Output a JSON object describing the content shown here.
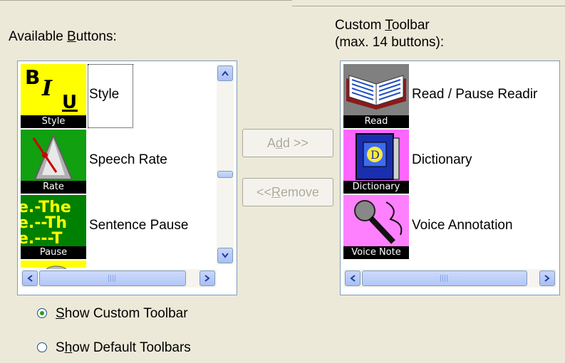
{
  "available": {
    "label_pre": "Available ",
    "label_accel": "B",
    "label_post": "uttons:",
    "items": [
      {
        "label": "Style",
        "icon": "style-icon",
        "caption": "Style"
      },
      {
        "label": "Speech Rate",
        "icon": "metronome-icon",
        "caption": "Rate"
      },
      {
        "label": "Sentence Pause",
        "icon": "sentence-pause-icon",
        "caption": "Pause"
      }
    ]
  },
  "custom": {
    "label_line1_pre": "Custom ",
    "label_line1_accel": "T",
    "label_line1_post": "oolbar",
    "label_line2": "(max. 14 buttons):",
    "items": [
      {
        "label": "Read / Pause Readir",
        "icon": "book-icon",
        "caption": "Read"
      },
      {
        "label": "Dictionary",
        "icon": "dictionary-icon",
        "caption": "Dictionary"
      },
      {
        "label": "Voice Annotation",
        "icon": "microphone-icon",
        "caption": "Voice Note"
      }
    ]
  },
  "buttons": {
    "add_pre": "A",
    "add_accel": "d",
    "add_post": "d >>",
    "remove_pre": "<< ",
    "remove_accel": "R",
    "remove_post": "emove"
  },
  "options": {
    "show_custom_accel": "S",
    "show_custom_post": "how Custom Toolbar",
    "show_custom_checked": true,
    "show_default_pre": "S",
    "show_default_accel": "h",
    "show_default_post": "ow Default Toolbars",
    "show_default_checked": false
  },
  "colors": {
    "style_bg": "#ffff00",
    "rate_bg": "#10a010",
    "pause_bg": "#008000",
    "read_bg": "#808080",
    "dict_bg": "#ff66ff",
    "voice_bg": "#ff80ff"
  }
}
